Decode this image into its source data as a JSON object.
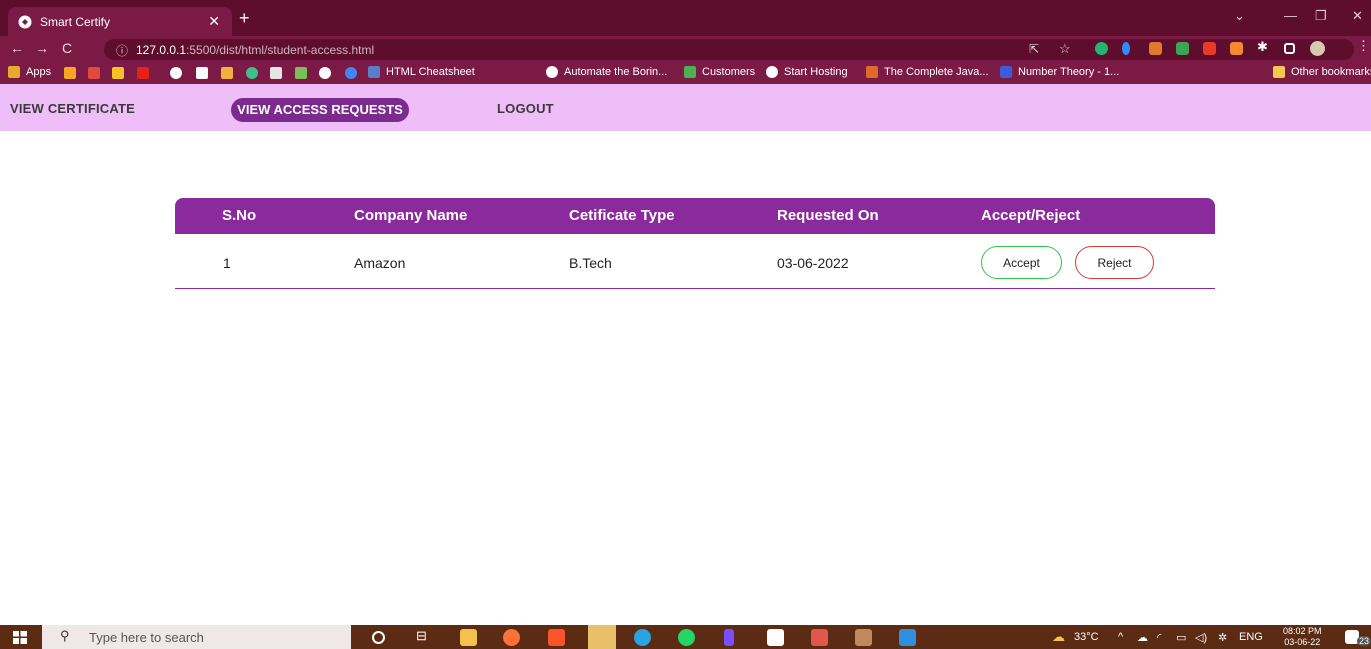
{
  "browser": {
    "tab_title": "Smart Certify",
    "url_host": "127.0.0.1",
    "url_rest": ":5500/dist/html/student-access.html",
    "bookmarks": [
      "Apps",
      "HTML Cheatsheet",
      "Automate the Borin...",
      "Customers",
      "Start Hosting",
      "The Complete Java...",
      "Number Theory - 1...",
      "Other bookmarks"
    ]
  },
  "nav": {
    "view_certificate": "VIEW CERTIFICATE",
    "view_access_requests": "VIEW ACCESS REQUESTS",
    "logout": "LOGOUT"
  },
  "table": {
    "headers": [
      "S.No",
      "Company Name",
      "Cetificate Type",
      "Requested On",
      "Accept/Reject"
    ],
    "rows": [
      {
        "sno": "1",
        "company": "Amazon",
        "type": "B.Tech",
        "requested_on": "03-06-2022",
        "accept": "Accept",
        "reject": "Reject"
      }
    ]
  },
  "taskbar": {
    "search_placeholder": "Type here to search",
    "weather": "33°C",
    "lang": "ENG",
    "time": "08:02 PM",
    "date": "03-06-22",
    "notifications": "23"
  },
  "colors": {
    "accent": "#8a2a9c",
    "nav_bg": "#efbef8",
    "accept_border": "#31c54a",
    "reject_border": "#d63a3a"
  }
}
